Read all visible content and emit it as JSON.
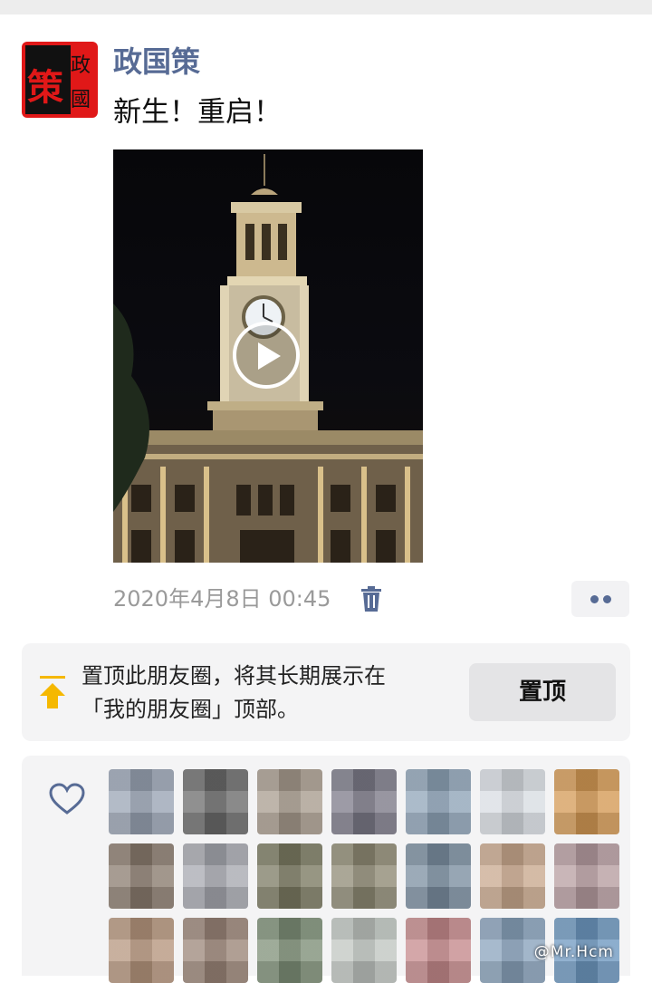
{
  "post": {
    "author": "政国策",
    "text": "新生！重启！",
    "timestamp": "2020年4月8日 00:45",
    "avatar_glyphs": {
      "main": "策",
      "top": "政",
      "bottom": "國"
    }
  },
  "pin": {
    "description_line1": "置顶此朋友圈，将其长期展示在",
    "description_line2": "「我的朋友圈」顶部。",
    "button_label": "置顶",
    "icon": "pin-top-icon",
    "icon_color": "#f5b800"
  },
  "likes": {
    "icon": "heart-outline-icon",
    "avatar_colors": [
      "#9aa4b4",
      "#6b6b6b",
      "#a89c8e",
      "#7c7a88",
      "#8fa4b8",
      "#d8dde2",
      "#d49a55",
      "#8a7b6e",
      "#a7a9b0",
      "#7b7a62",
      "#8e8a74",
      "#7b8ea0",
      "#c9a98e",
      "#b79da1",
      "#b6967e",
      "#9b8578",
      "#7e8f77",
      "#c0c6c1",
      "#c58a8c",
      "#8aa3bc",
      "#6e98c0"
    ]
  },
  "colors": {
    "author_link": "#576b95",
    "accent_red": "#e01818",
    "timestamp_gray": "#9a9a9a"
  }
}
